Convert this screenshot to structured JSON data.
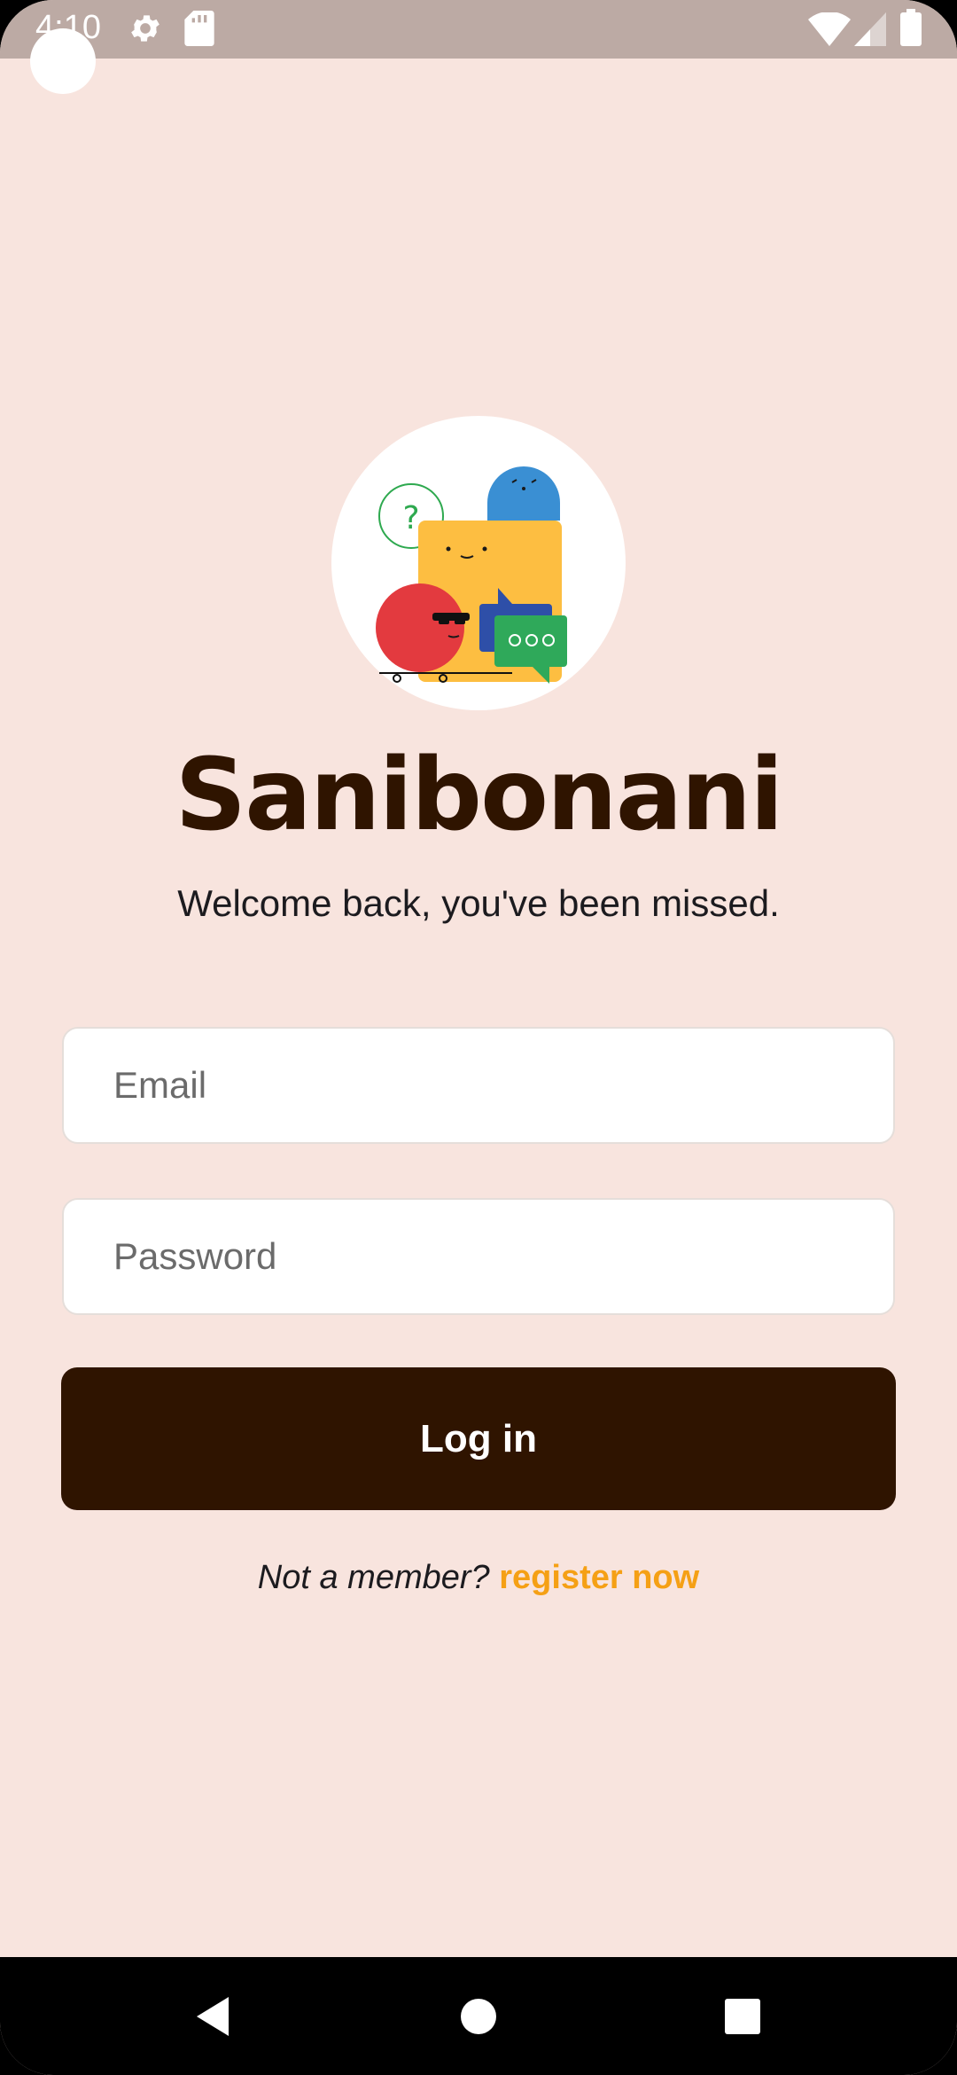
{
  "status_bar": {
    "time": "4:10",
    "icons": [
      "settings-icon",
      "sd-card-icon",
      "wifi-icon",
      "signal-icon",
      "battery-icon"
    ]
  },
  "app": {
    "name": "Sanibonani",
    "welcome": "Welcome back, you've been missed."
  },
  "form": {
    "email_placeholder": "Email",
    "password_placeholder": "Password",
    "login_label": "Log in"
  },
  "register": {
    "question": "Not a member?",
    "link_label": "register now"
  },
  "colors": {
    "background": "#F8E4DE",
    "primary": "#2F1400",
    "accent": "#F5A015",
    "status_bar": "#BCAAA4"
  },
  "nav_bar": {
    "icons": [
      "back-icon",
      "home-icon",
      "recents-icon"
    ]
  }
}
